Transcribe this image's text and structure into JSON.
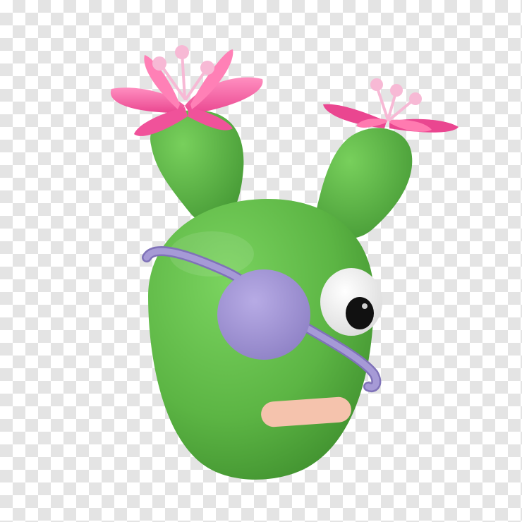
{
  "image": {
    "subject-icon": "cactus-character-icon",
    "background": "transparency-checkerboard",
    "colors": {
      "checker_light": "#ffffff",
      "checker_dark": "#e4e4e4",
      "cactus_green": "#5cb544",
      "cactus_dark": "#3f8f2e",
      "flower_pink": "#f0529a",
      "flower_pink_light": "#ff86bb",
      "stamen": "#f7b9d5",
      "eyepatch_purple": "#a69ad6",
      "eye_white": "#ffffff",
      "pupil": "#111111",
      "mouth": "#f5c3ad"
    }
  }
}
